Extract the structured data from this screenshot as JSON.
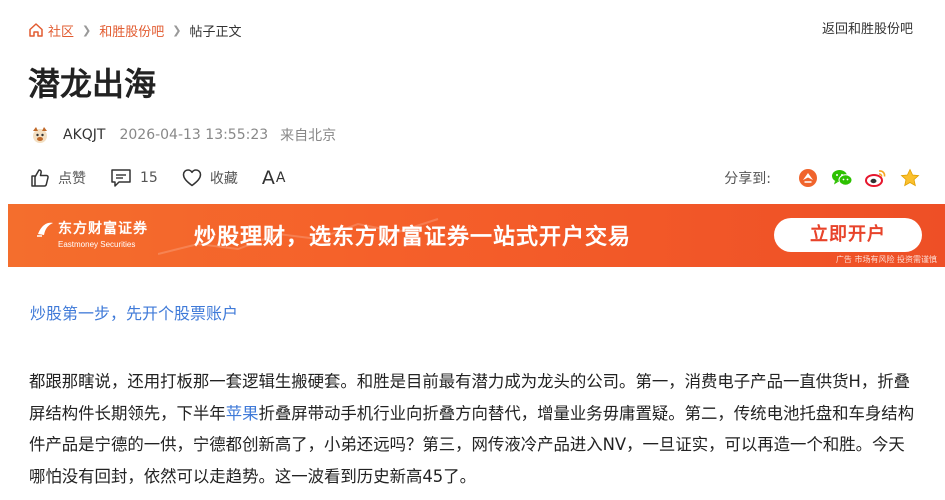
{
  "breadcrumb": {
    "items": [
      "社区",
      "和胜股份吧"
    ],
    "current": "帖子正文",
    "back": "返回和胜股份吧"
  },
  "post": {
    "title": "潜龙出海",
    "author": "AKQJT",
    "time": "2026-04-13 13:55:23",
    "location": "来自北京"
  },
  "actions": {
    "like": "点赞",
    "comments": "15",
    "favorite": "收藏",
    "font_big": "A",
    "font_small": "A",
    "share_label": "分享到:"
  },
  "banner": {
    "brand_cn": "东方财富证券",
    "brand_en": "Eastmoney Securities",
    "slogan": "炒股理财，选东方财富证券一站式开户交易",
    "button": "立即开户",
    "ad_note": "广告 市场有风险 投资需谨慎"
  },
  "promo_link": "炒股第一步，先开个股票账户",
  "content": {
    "part1": "都跟那瞎说，还用打板那一套逻辑生搬硬套。和胜是目前最有潜力成为龙头的公司。第一，消费电子产品一直供货H，折叠屏结构件长期领先，下半年",
    "link": "苹果",
    "part2": "折叠屏带动手机行业向折叠方向替代，增量业务毋庸置疑。第二，传统电池托盘和车身结构件产品是宁德的一供，宁德都创新高了，小弟还远吗？第三，网传液冷产品进入NV，一旦证实，可以再造一个和胜。今天哪怕没有回封，依然可以走趋势。这一波看到历史新高45了。"
  },
  "colors": {
    "accent": "#e25c31",
    "link": "#3f7ad8",
    "banner": "#f5602a"
  }
}
